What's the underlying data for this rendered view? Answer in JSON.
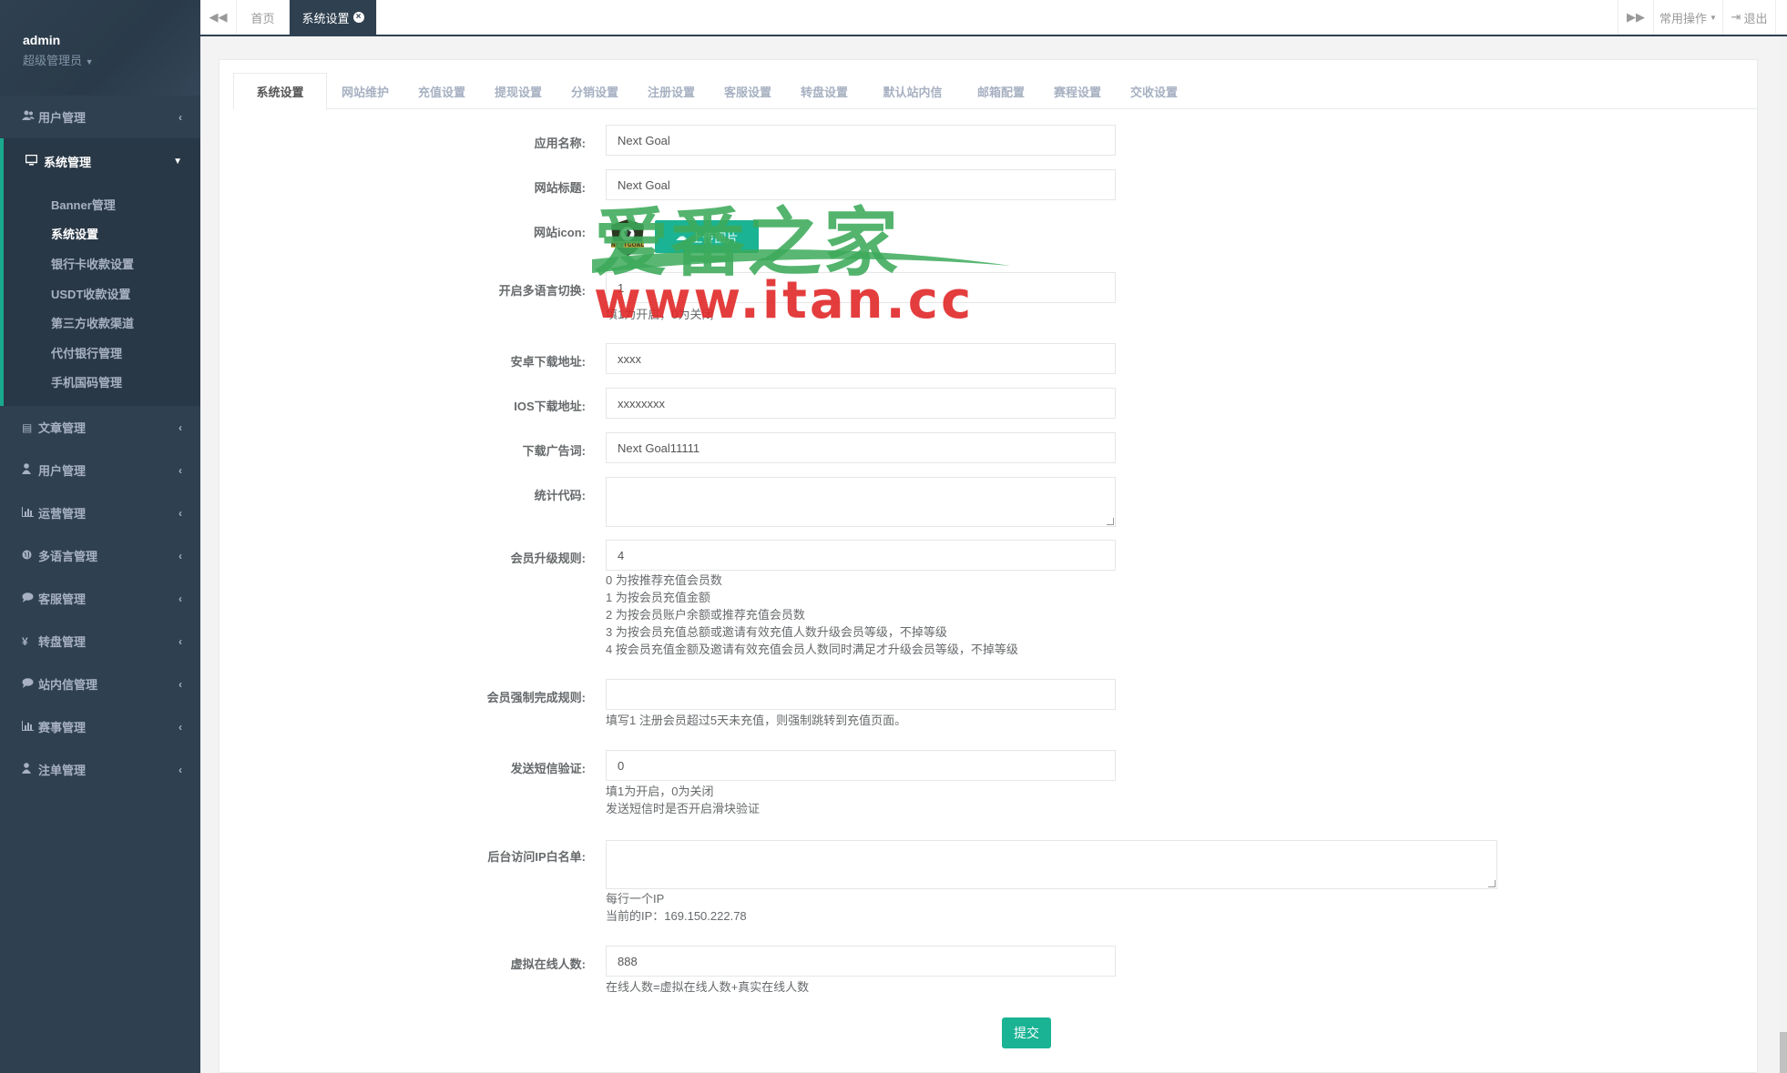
{
  "user": {
    "name": "admin",
    "role": "超级管理员"
  },
  "sidebar": {
    "top_item": {
      "label": "用户管理",
      "icon": "users-icon"
    },
    "active_group": {
      "label": "系统管理",
      "icon": "desktop-icon",
      "items": [
        "Banner管理",
        "系统设置",
        "银行卡收款设置",
        "USDT收款设置",
        "第三方收款渠道",
        "代付银行管理",
        "手机国码管理"
      ]
    },
    "items": [
      {
        "label": "文章管理",
        "icon": "book-icon"
      },
      {
        "label": "用户管理",
        "icon": "user-icon"
      },
      {
        "label": "运营管理",
        "icon": "bar-chart-icon"
      },
      {
        "label": "多语言管理",
        "icon": "globe-icon"
      },
      {
        "label": "客服管理",
        "icon": "comment-icon"
      },
      {
        "label": "转盘管理",
        "icon": "yen-icon"
      },
      {
        "label": "站内信管理",
        "icon": "comment-icon"
      },
      {
        "label": "赛事管理",
        "icon": "bar-chart-icon"
      },
      {
        "label": "注单管理",
        "icon": "user-icon"
      }
    ]
  },
  "topbar": {
    "tabs": [
      "首页",
      "系统设置"
    ],
    "common_ops": "常用操作",
    "logout": "退出"
  },
  "settings_tabs": [
    "系统设置",
    "网站维护",
    "充值设置",
    "提现设置",
    "分销设置",
    "注册设置",
    "客服设置",
    "转盘设置",
    "默认站内信",
    "邮箱配置",
    "赛程设置",
    "交收设置"
  ],
  "form": {
    "app_name": {
      "label": "应用名称:",
      "value": "Next Goal"
    },
    "site_title": {
      "label": "网站标题:",
      "value": "Next Goal"
    },
    "site_icon": {
      "label": "网站icon:",
      "button": "上传图片"
    },
    "multi_lang": {
      "label": "开启多语言切换:",
      "value": "1",
      "help": "填1为开启，0为关闭"
    },
    "android_url": {
      "label": "安卓下载地址:",
      "value": "xxxx"
    },
    "ios_url": {
      "label": "IOS下载地址:",
      "value": "xxxxxxxx"
    },
    "download_ad": {
      "label": "下载广告词:",
      "value": "Next Goal11111"
    },
    "stats_code": {
      "label": "统计代码:",
      "value": ""
    },
    "upgrade_rule": {
      "label": "会员升级规则:",
      "value": "4",
      "help": [
        "0 为按推荐充值会员数",
        "1 为按会员充值金额",
        "2 为按会员账户余额或推荐充值会员数",
        "3 为按会员充值总额或邀请有效充值人数升级会员等级，不掉等级",
        "4 按会员充值金额及邀请有效充值会员人数同时满足才升级会员等级，不掉等级"
      ]
    },
    "force_rule": {
      "label": "会员强制完成规则:",
      "value": "",
      "help": "填写1 注册会员超过5天未充值，则强制跳转到充值页面。"
    },
    "sms_verify": {
      "label": "发送短信验证:",
      "value": "0",
      "help": [
        "填1为开启，0为关闭",
        "发送短信时是否开启滑块验证"
      ]
    },
    "ip_whitelist": {
      "label": "后台访问IP白名单:",
      "value": "",
      "help": [
        "每行一个IP",
        "当前的IP：169.150.222.78"
      ]
    },
    "virtual_online": {
      "label": "虚拟在线人数:",
      "value": "888",
      "help": "在线人数=虚拟在线人数+真实在线人数"
    },
    "submit": "提交"
  },
  "watermark": {
    "line1": "爱番之家",
    "line2": "www.itan.cc"
  },
  "colors": {
    "sidebar": "#2f4050",
    "accent": "#1ab394",
    "watermark_green": "#3caa5a",
    "watermark_red": "#e12828"
  }
}
